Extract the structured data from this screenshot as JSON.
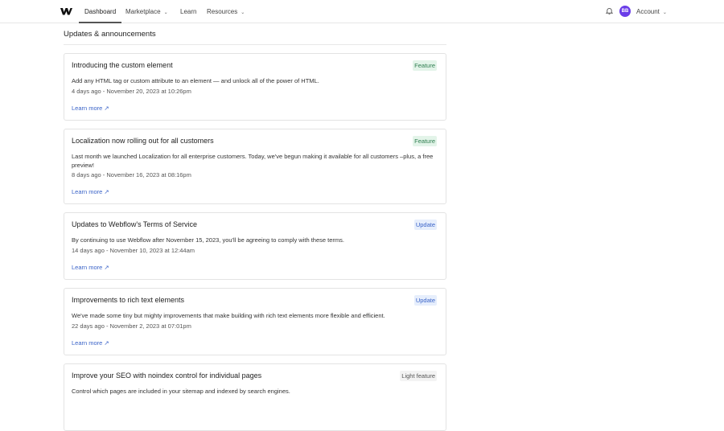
{
  "nav": {
    "items": [
      {
        "label": "Dashboard"
      },
      {
        "label": "Marketplace"
      },
      {
        "label": "Learn"
      },
      {
        "label": "Resources"
      }
    ],
    "avatar": "BB",
    "account": "Account"
  },
  "heading": "Updates & announcements",
  "learn_more": "Learn more ↗",
  "cards": [
    {
      "title": "Introducing the custom element",
      "badge": "Feature",
      "desc": "Add any HTML tag or custom attribute to an element — and unlock all of the power of HTML.",
      "date": "4 days ago - November 20, 2023 at 10:26pm"
    },
    {
      "title": "Localization now rolling out for all customers",
      "badge": "Feature",
      "desc": "Last month we launched Localization for all enterprise customers. Today, we've begun making it available for all customers –plus, a free preview!",
      "date": "8 days ago - November 16, 2023 at 08:16pm"
    },
    {
      "title": "Updates to Webflow's Terms of Service",
      "badge": "Update",
      "desc": "By continuing to use Webflow after November 15, 2023, you'll be agreeing to comply with these terms.",
      "date": "14 days ago - November 10, 2023 at 12:44am"
    },
    {
      "title": "Improvements to rich text elements",
      "badge": "Update",
      "desc": "We've made some tiny but mighty improvements that make building with rich text elements more flexible and efficient.",
      "date": "22 days ago - November 2, 2023 at 07:01pm"
    },
    {
      "title": "Improve your SEO with noindex control for individual pages",
      "badge": "Light feature",
      "desc": "Control which pages are included in your sitemap and indexed by search engines."
    }
  ]
}
